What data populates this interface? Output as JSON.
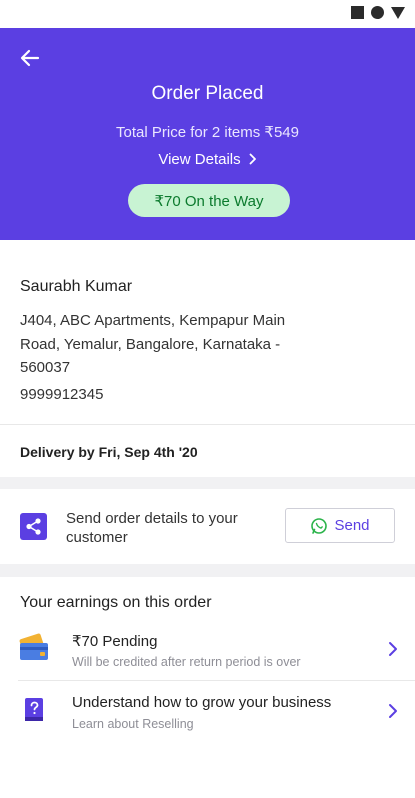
{
  "header": {
    "title": "Order Placed",
    "total": "Total Price for 2 items ₹549",
    "view_details": "View Details",
    "status_pill": "₹70 On the Way",
    "bg_color": "#5b3fe2"
  },
  "address": {
    "name": "Saurabh Kumar",
    "line1": "J404, ABC Apartments, Kempapur Main",
    "line2": "Road, Yemalur, Bangalore, Karnataka -",
    "line3": "560037",
    "phone": "9999912345"
  },
  "delivery": {
    "text": "Delivery by Fri, Sep 4th '20"
  },
  "share": {
    "text": "Send order details to your customer",
    "send_label": "Send"
  },
  "earnings": {
    "title": "Your earnings on this order",
    "items": [
      {
        "title": "₹70 Pending",
        "subtitle": "Will be credited after return period is over",
        "icon": "wallet-icon"
      },
      {
        "title": "Understand how to grow your business",
        "subtitle": "Learn about Reselling",
        "icon": "help-book-icon"
      }
    ]
  }
}
